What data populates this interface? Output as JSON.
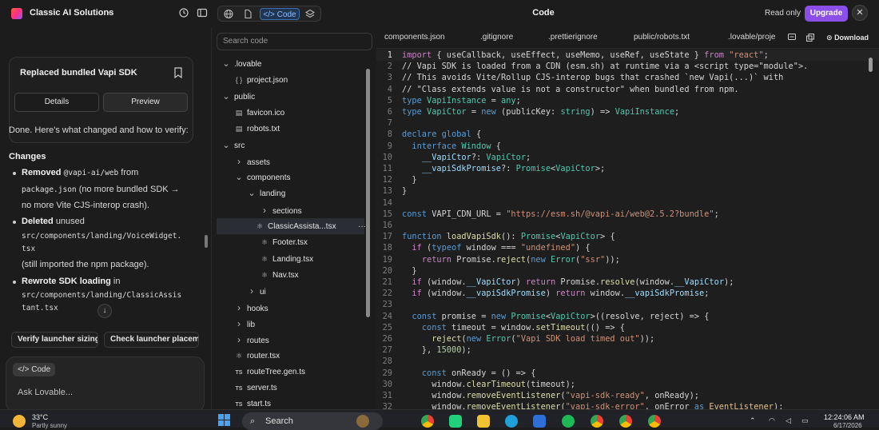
{
  "app": {
    "brand": "Classic AI Solutions",
    "center_title": "Code",
    "read_only": "Read only",
    "upgrade": "Upgrade"
  },
  "view_tabs": {
    "code": "Code"
  },
  "chat": {
    "card": {
      "title": "Replaced bundled Vapi SDK",
      "details": "Details",
      "preview": "Preview"
    },
    "intro": "Done. Here's what changed and how to verify:",
    "changes_heading": "Changes",
    "b1": {
      "lead": "Removed",
      "code": "@vapi-ai/web",
      "rest": "from",
      "code2": "package.json",
      "rest2": "(no more bundled SDK →",
      "rest3": "no more Vite CJS-interop crash)."
    },
    "b2": {
      "lead": "Deleted",
      "rest": "unused",
      "code": "src/components/landing/VoiceWidget.",
      "code_b": "tsx",
      "rest2": "(still imported the npm package)."
    },
    "b3": {
      "lead": "Rewrote SDK loading",
      "rest": "in",
      "code": "src/components/landing/ClassicAssis",
      "code_b": "tant.tsx"
    },
    "scroll_icon": "↓",
    "suggestions": [
      "Verify launcher sizing",
      "Check launcher placeme"
    ],
    "composer": {
      "chip": "Code",
      "placeholder": "Ask Lovable..."
    }
  },
  "tree": {
    "search_placeholder": "Search code",
    "nodes": [
      {
        "label": ".lovable",
        "kind": "folder-open"
      },
      {
        "label": "project.json",
        "kind": "json"
      },
      {
        "label": "public",
        "kind": "folder-open"
      },
      {
        "label": "favicon.ico",
        "kind": "file"
      },
      {
        "label": "robots.txt",
        "kind": "file"
      },
      {
        "label": "src",
        "kind": "folder-open"
      },
      {
        "label": "assets",
        "kind": "folder"
      },
      {
        "label": "components",
        "kind": "folder-open"
      },
      {
        "label": "landing",
        "kind": "folder-open"
      },
      {
        "label": "sections",
        "kind": "folder"
      },
      {
        "label": "ClassicAssista...tsx",
        "kind": "react"
      },
      {
        "label": "Footer.tsx",
        "kind": "react"
      },
      {
        "label": "Landing.tsx",
        "kind": "react"
      },
      {
        "label": "Nav.tsx",
        "kind": "react"
      },
      {
        "label": "ui",
        "kind": "folder"
      },
      {
        "label": "hooks",
        "kind": "folder"
      },
      {
        "label": "lib",
        "kind": "folder"
      },
      {
        "label": "routes",
        "kind": "folder"
      },
      {
        "label": "router.tsx",
        "kind": "react"
      },
      {
        "label": "routeTree.gen.ts",
        "kind": "ts"
      },
      {
        "label": "server.ts",
        "kind": "ts"
      },
      {
        "label": "start.ts",
        "kind": "ts"
      }
    ],
    "more": "···"
  },
  "editor": {
    "tabs": [
      "components.json",
      ".gitignore",
      ".prettierignore",
      "public/robots.txt",
      ".lovable/proje"
    ],
    "download": "Download",
    "line_numbers": [
      "1",
      "2",
      "3",
      "4",
      "5",
      "6",
      "7",
      "8",
      "9",
      "10",
      "11",
      "12",
      "13",
      "14",
      "15",
      "16",
      "17",
      "18",
      "19",
      "20",
      "21",
      "22",
      "23",
      "24",
      "25",
      "26",
      "27",
      "28",
      "29",
      "30",
      "31",
      "32"
    ]
  },
  "taskbar": {
    "temp": "33°C",
    "weather": "Partly sunny",
    "search": "Search",
    "time": "12:24:06 AM",
    "date": "6/17/2026"
  }
}
